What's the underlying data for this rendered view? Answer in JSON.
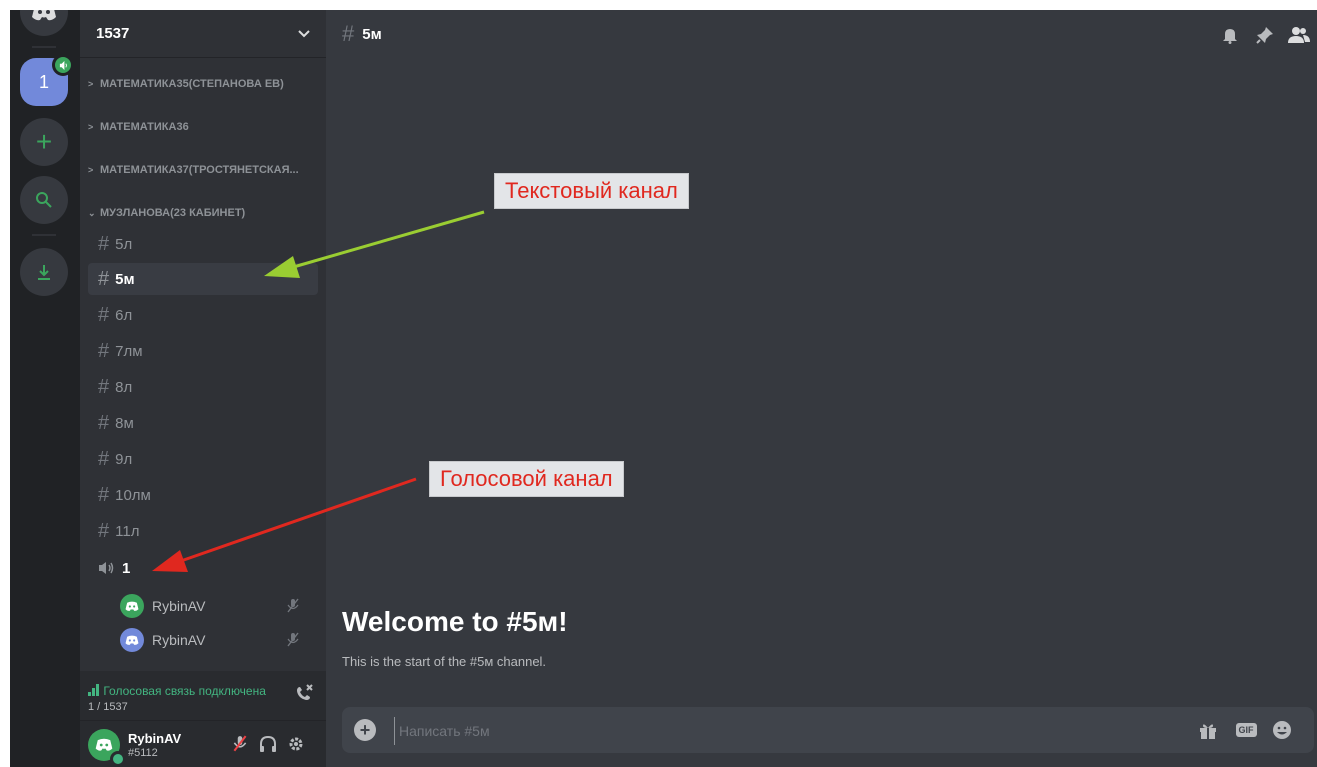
{
  "server": {
    "name": "1537",
    "active_badge": "1"
  },
  "categories": [
    {
      "label": "МАТЕМАТИКА35(СТЕПАНОВА ЕВ)",
      "expanded": false
    },
    {
      "label": "МАТЕМАТИКА36",
      "expanded": false
    },
    {
      "label": "МАТЕМАТИКА37(ТРОСТЯНЕТСКАЯ...",
      "expanded": false
    },
    {
      "label": "МУЗЛАНОВА(23 КАБИНЕТ)",
      "expanded": true
    }
  ],
  "text_channels": [
    "5л",
    "5м",
    "6л",
    "7лм",
    "8л",
    "8м",
    "9л",
    "10лм",
    "11л"
  ],
  "active_channel": "5м",
  "voice_channel": {
    "name": "1",
    "users": [
      "RybinAV",
      "RybinAV"
    ]
  },
  "voice_status": {
    "text": "Голосовая связь подключена",
    "sub": "1 / 1537"
  },
  "user": {
    "name": "RybinAV",
    "tag": "#5112"
  },
  "main": {
    "channel_title": "5м",
    "welcome_title": "Welcome to #5м!",
    "welcome_sub": "This is the start of the #5м channel.",
    "composer_placeholder": "Написать #5м",
    "gif_label": "GIF"
  },
  "annotations": {
    "text_channel": "Текстовый канал",
    "voice_channel": "Голосовой канал"
  },
  "colors": {
    "accent": "#7289da",
    "online": "#43b581",
    "arrow_text": "#9acd32",
    "arrow_voice": "#e0281f"
  }
}
